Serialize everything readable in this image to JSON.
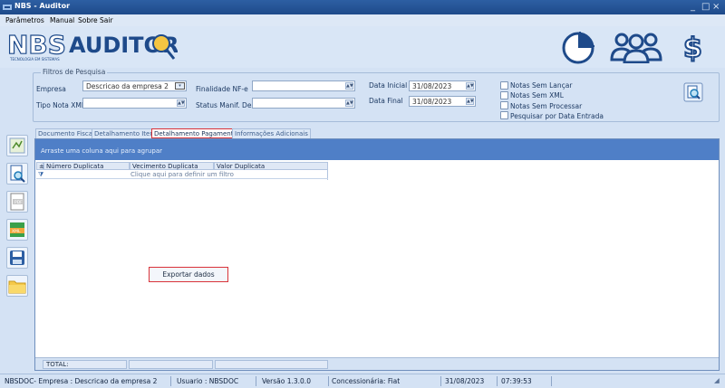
{
  "window": {
    "title": "NBS - Auditor",
    "controls": [
      "_",
      "□",
      "×"
    ]
  },
  "menu": [
    "Parâmetros",
    "Manual",
    "Sobre",
    "Sair"
  ],
  "logo": {
    "nbs": "NBS",
    "tagline": "TECNOLOGIA EM SISTEMAS",
    "auditor": "AUDITOR"
  },
  "header_icons": [
    "pie-chart-icon",
    "users-icon",
    "dollar-icon"
  ],
  "filters": {
    "legend": "Filtros de Pesquisa",
    "empresa_label": "Empresa",
    "empresa_value": "Descricao da empresa 2",
    "tipo_nota_label": "Tipo Nota XML",
    "tipo_nota_value": "",
    "finalidade_label": "Finalidade NF-e",
    "finalidade_value": "",
    "status_label": "Status Manif. Dest:",
    "status_value": "",
    "data_inicial_label": "Data Inicial",
    "data_inicial_value": "31/08/2023",
    "data_final_label": "Data Final",
    "data_final_value": "31/08/2023",
    "checkboxes": [
      "Notas Sem Lançar",
      "Notas Sem XML",
      "Notas Sem Processar",
      "Pesquisar por Data Entrada"
    ]
  },
  "side_tools": [
    "settings-tool-icon",
    "document-search-icon",
    "pdf-icon",
    "xml-icon",
    "save-icon",
    "folder-icon"
  ],
  "tabs": [
    "Documento Fiscais",
    "Detalhamento Itens",
    "Detalhamento Pagamento",
    "Informações Adicionais"
  ],
  "grid": {
    "group_hint": "Arraste uma coluna aqui para agrupar",
    "columns": [
      "Número Duplicata",
      "Vecimento Duplicata",
      "Valor Duplicata"
    ],
    "filter_hint": "Clique aqui para definir um filtro",
    "export_label": "Exportar dados",
    "total_label": "TOTAL:"
  },
  "status": {
    "empresa": "NBSDOC- Empresa : Descricao da empresa 2",
    "usuario": "Usuario : NBSDOC",
    "versao": "Versão 1.3.0.0",
    "concessionaria": "Concessionária: Fiat",
    "data": "31/08/2023",
    "hora": "07:39:53"
  },
  "colors": {
    "accent": "#2d5fa3",
    "highlight": "#d9333a",
    "groupbar": "#4f7fc7"
  }
}
